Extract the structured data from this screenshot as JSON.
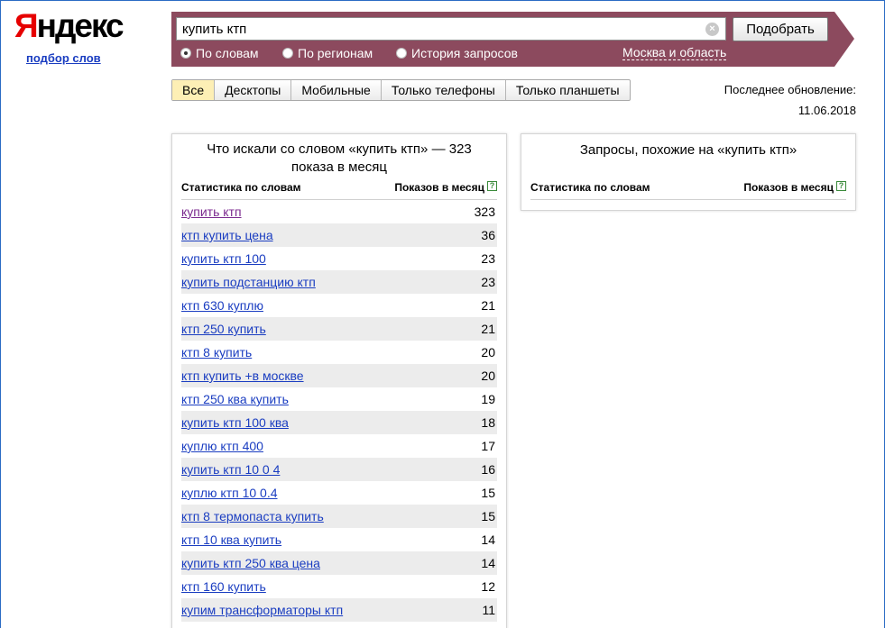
{
  "header": {
    "logo": "Яндекс",
    "service_link": "подбор слов"
  },
  "search": {
    "query": "купить ктп",
    "submit_label": "Подобрать",
    "radio_options": [
      {
        "label": "По словам",
        "selected": true
      },
      {
        "label": "По регионам",
        "selected": false
      },
      {
        "label": "История запросов",
        "selected": false
      }
    ],
    "region": "Москва и область",
    "bar_color": "#8c4a5e"
  },
  "device_tabs": [
    {
      "label": "Все",
      "active": true
    },
    {
      "label": "Десктопы",
      "active": false
    },
    {
      "label": "Мобильные",
      "active": false
    },
    {
      "label": "Только телефоны",
      "active": false
    },
    {
      "label": "Только планшеты",
      "active": false
    }
  ],
  "update": {
    "label": "Последнее обновление:",
    "date": "11.06.2018"
  },
  "left_panel": {
    "title": "Что искали со словом «купить ктп» — 323 показа в месяц",
    "col_phrase": "Статистика по словам",
    "col_count": "Показов в месяц",
    "rows": [
      {
        "phrase": "купить ктп",
        "count": "323"
      },
      {
        "phrase": "ктп купить цена",
        "count": "36"
      },
      {
        "phrase": "купить ктп 100",
        "count": "23"
      },
      {
        "phrase": "купить подстанцию ктп",
        "count": "23"
      },
      {
        "phrase": "ктп 630 куплю",
        "count": "21"
      },
      {
        "phrase": "ктп 250 купить",
        "count": "21"
      },
      {
        "phrase": "ктп 8 купить",
        "count": "20"
      },
      {
        "phrase": "ктп купить +в москве",
        "count": "20"
      },
      {
        "phrase": "ктп 250 ква купить",
        "count": "19"
      },
      {
        "phrase": "купить ктп 100 ква",
        "count": "18"
      },
      {
        "phrase": "куплю ктп 400",
        "count": "17"
      },
      {
        "phrase": "купить ктп 10 0 4",
        "count": "16"
      },
      {
        "phrase": "куплю ктп 10 0.4",
        "count": "15"
      },
      {
        "phrase": "ктп 8 термопаста купить",
        "count": "15"
      },
      {
        "phrase": "ктп 10 ква купить",
        "count": "14"
      },
      {
        "phrase": "купить ктп 250 ква цена",
        "count": "14"
      },
      {
        "phrase": "ктп 160 купить",
        "count": "12"
      },
      {
        "phrase": "купим трансформаторы ктп",
        "count": "11"
      }
    ]
  },
  "right_panel": {
    "title": "Запросы, похожие на «купить ктп»",
    "col_phrase": "Статистика по словам",
    "col_count": "Показов в месяц"
  }
}
